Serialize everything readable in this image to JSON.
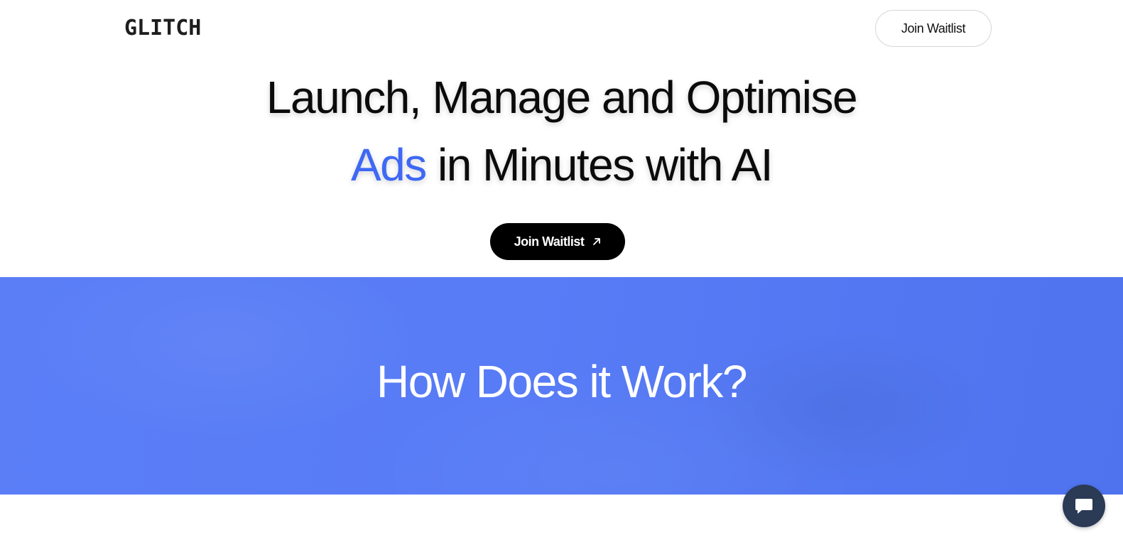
{
  "header": {
    "logo_text": "GLITCH",
    "cta_label": "Join Waitlist"
  },
  "hero": {
    "line1": "Launch, Manage and Optimise",
    "line2_accent": "Ads",
    "line2_rest": " in Minutes with AI",
    "cta_label": "Join Waitlist",
    "cta_icon": "arrow-up-right-icon"
  },
  "section": {
    "title": "How Does it Work?"
  },
  "chat_widget": {
    "icon": "chat-bubble-icon"
  },
  "colors": {
    "accent": "#3e68f5",
    "band": "#587cf6",
    "cta_bg": "#000000",
    "chat_bg": "#2b3a55"
  }
}
